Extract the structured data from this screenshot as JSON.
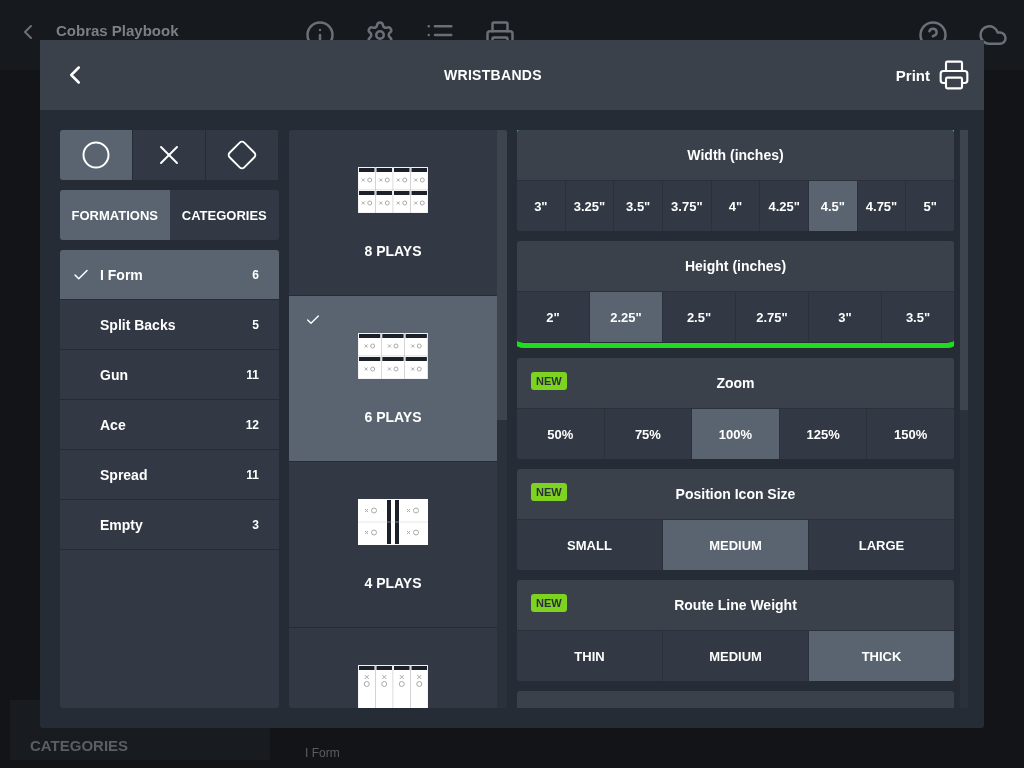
{
  "background": {
    "title": "Cobras Playbook",
    "footer_heading": "CATEGORIES",
    "footer_item": "I Form"
  },
  "dialog": {
    "title": "WRISTBANDS",
    "print_label": "Print"
  },
  "symbols": [
    {
      "kind": "circle",
      "selected": true
    },
    {
      "kind": "cross",
      "selected": false
    },
    {
      "kind": "diamond",
      "selected": false
    }
  ],
  "tabs": [
    {
      "label": "FORMATIONS",
      "selected": true
    },
    {
      "label": "CATEGORIES",
      "selected": false
    }
  ],
  "formations": [
    {
      "name": "I Form",
      "count": "6",
      "selected": true
    },
    {
      "name": "Split Backs",
      "count": "5",
      "selected": false
    },
    {
      "name": "Gun",
      "count": "11",
      "selected": false
    },
    {
      "name": "Ace",
      "count": "12",
      "selected": false
    },
    {
      "name": "Spread",
      "count": "11",
      "selected": false
    },
    {
      "name": "Empty",
      "count": "3",
      "selected": false
    }
  ],
  "layouts": [
    {
      "kind": "grid8",
      "label": "8 PLAYS",
      "selected": false
    },
    {
      "kind": "grid6",
      "label": "6 PLAYS",
      "selected": true
    },
    {
      "kind": "split4",
      "label": "4 PLAYS",
      "selected": false
    },
    {
      "kind": "column4",
      "selected": false
    }
  ],
  "highlighted_settings": [
    {
      "title": "Width (inches)",
      "options": [
        {
          "label": "3\"",
          "selected": false
        },
        {
          "label": "3.25\"",
          "selected": false
        },
        {
          "label": "3.5\"",
          "selected": false
        },
        {
          "label": "3.75\"",
          "selected": false
        },
        {
          "label": "4\"",
          "selected": false
        },
        {
          "label": "4.25\"",
          "selected": false
        },
        {
          "label": "4.5\"",
          "selected": true
        },
        {
          "label": "4.75\"",
          "selected": false
        },
        {
          "label": "5\"",
          "selected": false
        }
      ]
    },
    {
      "title": "Height (inches)",
      "options": [
        {
          "label": "2\"",
          "selected": false
        },
        {
          "label": "2.25\"",
          "selected": true
        },
        {
          "label": "2.5\"",
          "selected": false
        },
        {
          "label": "2.75\"",
          "selected": false
        },
        {
          "label": "3\"",
          "selected": false
        },
        {
          "label": "3.5\"",
          "selected": false
        }
      ]
    }
  ],
  "settings": [
    {
      "badge": "NEW",
      "title": "Zoom",
      "options": [
        {
          "label": "50%",
          "selected": false
        },
        {
          "label": "75%",
          "selected": false
        },
        {
          "label": "100%",
          "selected": true
        },
        {
          "label": "125%",
          "selected": false
        },
        {
          "label": "150%",
          "selected": false
        }
      ]
    },
    {
      "badge": "NEW",
      "title": "Position Icon Size",
      "options": [
        {
          "label": "SMALL",
          "selected": false
        },
        {
          "label": "MEDIUM",
          "selected": true
        },
        {
          "label": "LARGE",
          "selected": false
        }
      ]
    },
    {
      "badge": "NEW",
      "title": "Route Line Weight",
      "options": [
        {
          "label": "THIN",
          "selected": false
        },
        {
          "label": "MEDIUM",
          "selected": false
        },
        {
          "label": "THICK",
          "selected": true
        }
      ]
    }
  ]
}
